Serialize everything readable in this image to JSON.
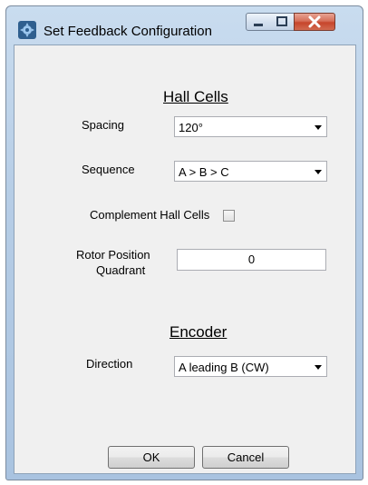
{
  "window": {
    "title": "Set Feedback Configuration"
  },
  "hall_cells": {
    "section_title": "Hall Cells",
    "spacing": {
      "label": "Spacing",
      "value": "120°"
    },
    "sequence": {
      "label": "Sequence",
      "value": "A > B > C"
    },
    "complement": {
      "label": "Complement Hall Cells",
      "checked": false
    },
    "rotor_position": {
      "label_line1": "Rotor Position",
      "label_line2": "Quadrant",
      "value": "0"
    }
  },
  "encoder": {
    "section_title": "Encoder",
    "direction": {
      "label": "Direction",
      "value": "A leading B (CW)"
    }
  },
  "buttons": {
    "ok": "OK",
    "cancel": "Cancel"
  },
  "icons": [
    "app-icon",
    "minimize-icon",
    "maximize-icon",
    "close-icon",
    "dropdown-arrow-icon"
  ]
}
